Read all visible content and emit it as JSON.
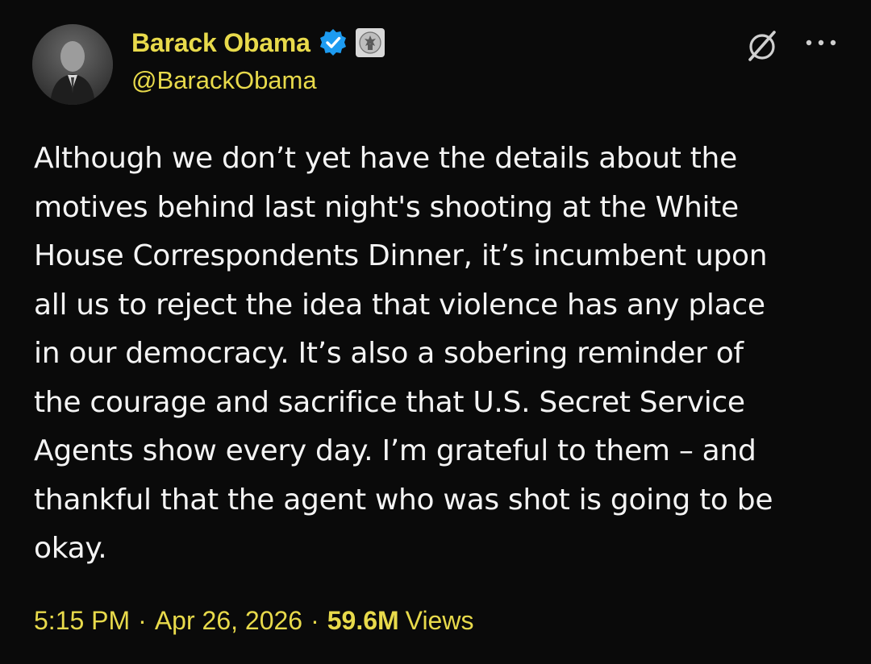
{
  "author": {
    "display_name": "Barack Obama",
    "handle": "@BarackObama",
    "verified_icon": "verified-badge-icon",
    "affiliation_icon": "government-seal-icon"
  },
  "actions": {
    "grok_icon": "grok-icon",
    "more_icon": "more-dots-icon"
  },
  "tweet": {
    "text": "Although we don’t yet have the details about the\nmotives behind last night's shooting at the White\nHouse Correspondents Dinner, it’s incumbent upon\nall us to reject the idea that violence has any place\nin our democracy. It’s also a sobering reminder of\nthe courage and sacrifice that U.S. Secret Service\nAgents show every day. I’m grateful to them – and\nthankful that the agent who was shot is going to be\nokay."
  },
  "meta": {
    "time": "5:15 PM",
    "separator": "·",
    "date": "Apr 26, 2026",
    "views_count": "59.6M",
    "views_label": "Views"
  },
  "colors": {
    "background": "#0a0a0a",
    "accent_text": "#e8da4b",
    "body_text": "#f4f4f4",
    "verified_blue": "#1d9bf0"
  }
}
